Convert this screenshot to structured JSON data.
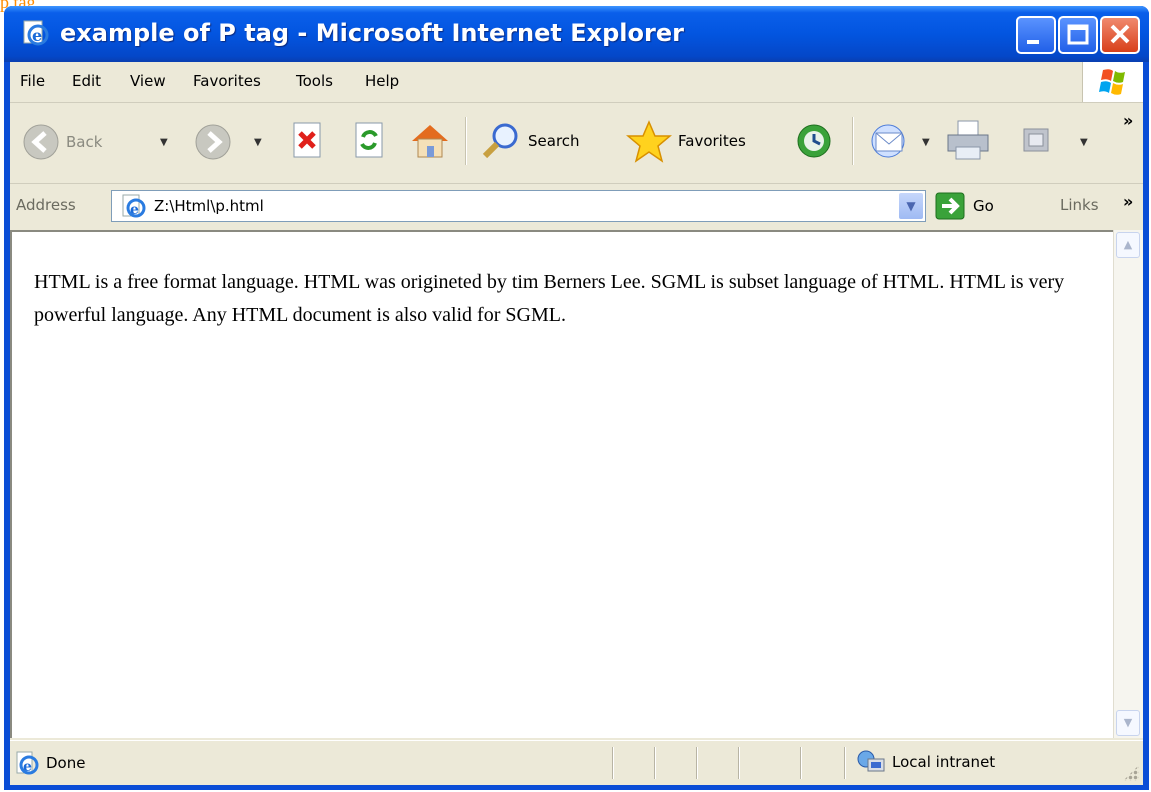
{
  "window": {
    "title": "example of P tag - Microsoft Internet Explorer",
    "controls": [
      "minimize",
      "maximize",
      "close"
    ]
  },
  "menubar": {
    "items": [
      "File",
      "Edit",
      "View",
      "Favorites",
      "Tools",
      "Help"
    ]
  },
  "toolbar": {
    "back_label": "Back",
    "search_label": "Search",
    "favorites_label": "Favorites",
    "more": "»"
  },
  "address": {
    "label": "Address",
    "value": "Z:\\Html\\p.html",
    "go_label": "Go",
    "links_label": "Links",
    "more": "»"
  },
  "content": {
    "paragraph": "HTML is a free format language. HTML was origineted by tim Berners Lee. SGML is subset language of HTML. HTML is very powerful language. Any HTML document is also valid for SGML."
  },
  "statusbar": {
    "status": "Done",
    "zone": "Local intranet"
  },
  "colors": {
    "titlebar": "#0355e0",
    "chrome": "#ece9d8",
    "page_bg": "#ffffff"
  }
}
